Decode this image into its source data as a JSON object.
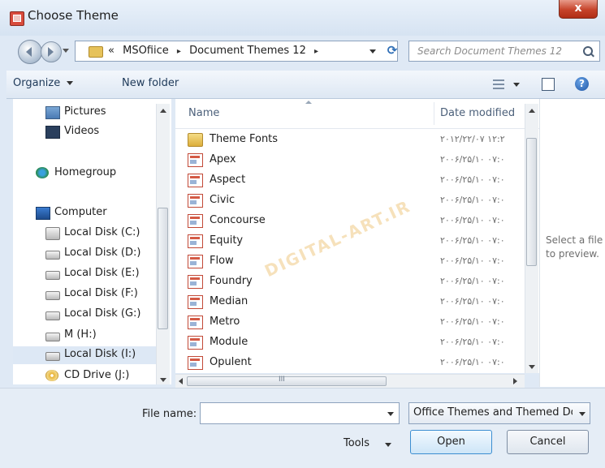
{
  "window": {
    "title": "Choose Theme",
    "close_label": "x"
  },
  "address": {
    "crumbs": [
      "«",
      "MSOfiice",
      "▸",
      "Document Themes 12",
      "▸"
    ]
  },
  "search": {
    "placeholder": "Search Document Themes 12"
  },
  "toolbar": {
    "organize_label": "Organize",
    "newfolder_label": "New folder",
    "help_label": "?"
  },
  "nav": {
    "items": [
      {
        "label": "Pictures",
        "icon": "pictures-icon"
      },
      {
        "label": "Videos",
        "icon": "videos-icon"
      },
      {
        "label": "Homegroup",
        "icon": "homegroup-icon"
      },
      {
        "label": "Computer",
        "icon": "computer-icon"
      },
      {
        "label": "Local Disk (C:)",
        "icon": "system-disk-icon"
      },
      {
        "label": "Local Disk (D:)",
        "icon": "disk-icon"
      },
      {
        "label": "Local Disk (E:)",
        "icon": "disk-icon"
      },
      {
        "label": "Local Disk (F:)",
        "icon": "disk-icon"
      },
      {
        "label": "Local Disk (G:)",
        "icon": "disk-icon"
      },
      {
        "label": "M (H:)",
        "icon": "disk-icon"
      },
      {
        "label": "Local Disk (I:)",
        "icon": "disk-icon"
      },
      {
        "label": "CD Drive (J:)",
        "icon": "cd-drive-icon"
      }
    ]
  },
  "columns": {
    "name": "Name",
    "date": "Date modified"
  },
  "files": [
    {
      "name": "Theme Fonts",
      "date": "۲۰۱۲/۲۲/۰۷ ۱۲:۲",
      "icon": "folder-icon"
    },
    {
      "name": "Apex",
      "date": "۲۰۰۶/۲۵/۱۰ ۰۷:۰",
      "icon": "theme-file-icon"
    },
    {
      "name": "Aspect",
      "date": "۲۰۰۶/۲۵/۱۰ ۰۷:۰",
      "icon": "theme-file-icon"
    },
    {
      "name": "Civic",
      "date": "۲۰۰۶/۲۵/۱۰ ۰۷:۰",
      "icon": "theme-file-icon"
    },
    {
      "name": "Concourse",
      "date": "۲۰۰۶/۲۵/۱۰ ۰۷:۰",
      "icon": "theme-file-icon"
    },
    {
      "name": "Equity",
      "date": "۲۰۰۶/۲۵/۱۰ ۰۷:۰",
      "icon": "theme-file-icon"
    },
    {
      "name": "Flow",
      "date": "۲۰۰۶/۲۵/۱۰ ۰۷:۰",
      "icon": "theme-file-icon"
    },
    {
      "name": "Foundry",
      "date": "۲۰۰۶/۲۵/۱۰ ۰۷:۰",
      "icon": "theme-file-icon"
    },
    {
      "name": "Median",
      "date": "۲۰۰۶/۲۵/۱۰ ۰۷:۰",
      "icon": "theme-file-icon"
    },
    {
      "name": "Metro",
      "date": "۲۰۰۶/۲۵/۱۰ ۰۷:۰",
      "icon": "theme-file-icon"
    },
    {
      "name": "Module",
      "date": "۲۰۰۶/۲۵/۱۰ ۰۷:۰",
      "icon": "theme-file-icon"
    },
    {
      "name": "Opulent",
      "date": "۲۰۰۶/۲۵/۱۰ ۰۷:۰",
      "icon": "theme-file-icon"
    }
  ],
  "preview": {
    "text": "Select a file to preview."
  },
  "watermark": {
    "text": "DIGITAL-ART.IR"
  },
  "footer": {
    "filename_label": "File name:",
    "filename_value": "",
    "filetype_value": "Office Themes and Themed Do",
    "tools_label": "Tools",
    "open_label": "Open",
    "cancel_label": "Cancel",
    "hscroll_grip": "III"
  },
  "colors": {
    "accent": "#3c8ed1",
    "close": "#c6432a",
    "frame": "#dfe9f5"
  }
}
